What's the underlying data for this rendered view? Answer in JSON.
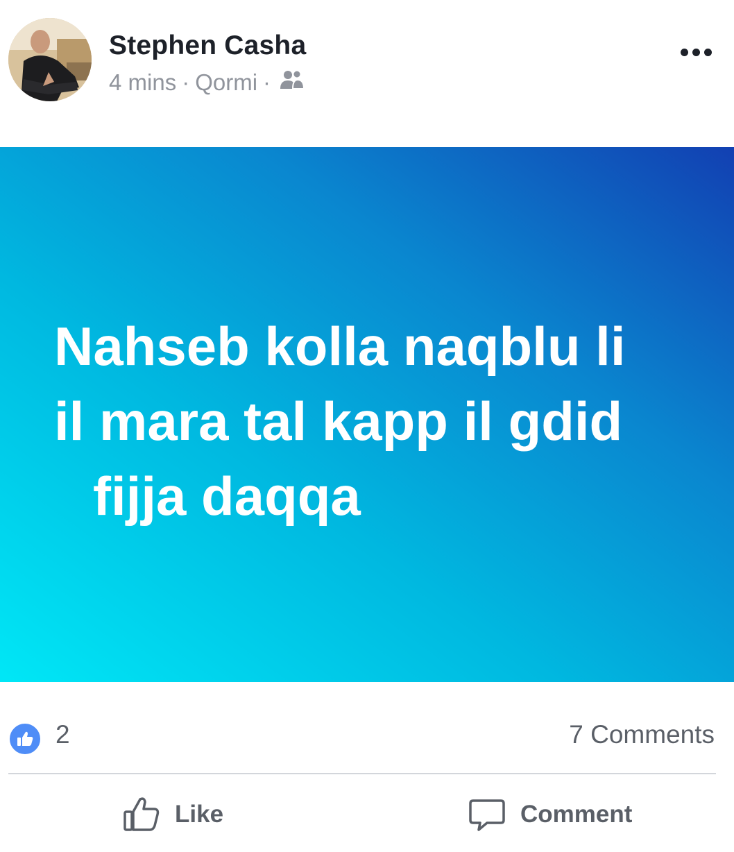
{
  "post": {
    "author": "Stephen Casha",
    "time": "4 mins",
    "separator": "·",
    "location": "Qormi",
    "audience_icon": "friends-icon",
    "more_icon": "more-options-icon",
    "text_lines": [
      "Nahseb kolla naqblu li",
      "il mara tal kapp il gdid",
      "fijja daqqa"
    ],
    "background": {
      "gradient_start": "#00e7f6",
      "gradient_end": "#1240b2",
      "text_color": "#ffffff"
    }
  },
  "reactions": {
    "icon": "like-badge-icon",
    "like_count": "2",
    "comments_label": "7 Comments",
    "badge_color": "#4f8df7"
  },
  "actions": {
    "like_label": "Like",
    "comment_label": "Comment"
  }
}
